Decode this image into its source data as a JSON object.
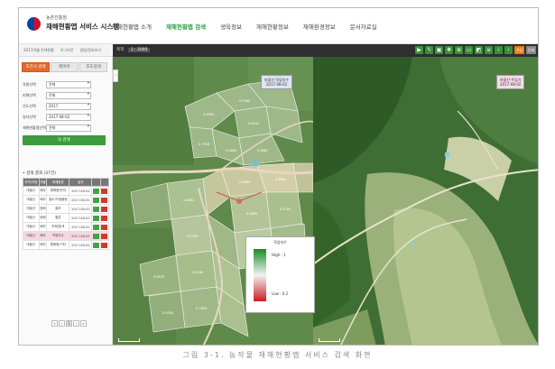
{
  "header": {
    "brand_small": "농촌진흥청",
    "brand_main": "재해현황맵 서비스 시스템",
    "nav": [
      "재해현황맵 소개",
      "재해현황맵 검색",
      "생육정보",
      "재해현황정보",
      "재해환경정보",
      "문서자료실"
    ],
    "active_nav_index": 1
  },
  "subheader": {
    "links": [
      "2017/4월 전체현황",
      "로그아웃",
      "알림/정보보기"
    ],
    "zoom_label": "축척",
    "zoom_value": "1 : 2000",
    "tool_icons": [
      "play-icon",
      "flash-icon",
      "save-icon",
      "pan-icon",
      "search-zoom-icon",
      "measure-icon",
      "area-icon",
      "ruler-icon",
      "prev-icon",
      "next-icon"
    ],
    "tool_btn_1": "저장",
    "tool_btn_2": "인쇄"
  },
  "sidebar": {
    "tabs": [
      "조건식 검색",
      "레이어",
      "조도검색"
    ],
    "active_tab_index": 0,
    "form": [
      {
        "label": "작물선택",
        "value": "전체"
      },
      {
        "label": "피해선택",
        "value": "전체"
      },
      {
        "label": "년도선택",
        "value": "2017"
      },
      {
        "label": "일자선택",
        "value": "2017-08-02"
      },
      {
        "label": "재해현황맵선택",
        "value": "전체"
      }
    ],
    "search_button": "Q 검색",
    "result_title": "• 검색 결과 (37건)",
    "table_headers": [
      "지역/지명",
      "작물",
      "피해종류",
      "일자",
      "",
      ""
    ],
    "rows": [
      [
        "마을산",
        "배추",
        "병해충/탄저",
        "2017-08-02"
      ],
      [
        "마을산",
        "배추",
        "밀도/자생불량",
        "2017-08-02"
      ],
      [
        "마을산",
        "양배",
        "홍조",
        "2017-08-02"
      ],
      [
        "마을산",
        "양배",
        "혈흔",
        "2017-08-02"
      ],
      [
        "마을산",
        "배추",
        "부패/탈색",
        "2017-08-02"
      ],
      [
        "마을산",
        "배추",
        "작업지수",
        "2017-08-02"
      ],
      [
        "마을산",
        "배추",
        "병해충/기타",
        "2017-08-02"
      ]
    ],
    "selected_row_index": 5,
    "pager": [
      "«",
      "‹",
      "1",
      "›",
      "»"
    ]
  },
  "maps": {
    "left_label": "마을산 작업지수",
    "left_date": "2017-08-02",
    "right_label": "마을산 주입기",
    "right_date": "2017-08-02",
    "parcel_values": [
      "0.6990",
      "0.7060",
      "0.6541",
      "0.7016",
      "0.5860",
      "0.6881",
      "0.4860",
      "0.6881",
      "0.5890",
      "0.4700",
      "0.6361",
      "0.5700",
      "0.6570",
      "0.6180",
      "0.6180",
      "0.7600"
    ]
  },
  "legend": {
    "title": "작업지수",
    "high": "High : 1",
    "low": "Low : 0.2"
  },
  "caption": "그림 3-1. 농작물 재해현황맵 서비스 검색 화면"
}
